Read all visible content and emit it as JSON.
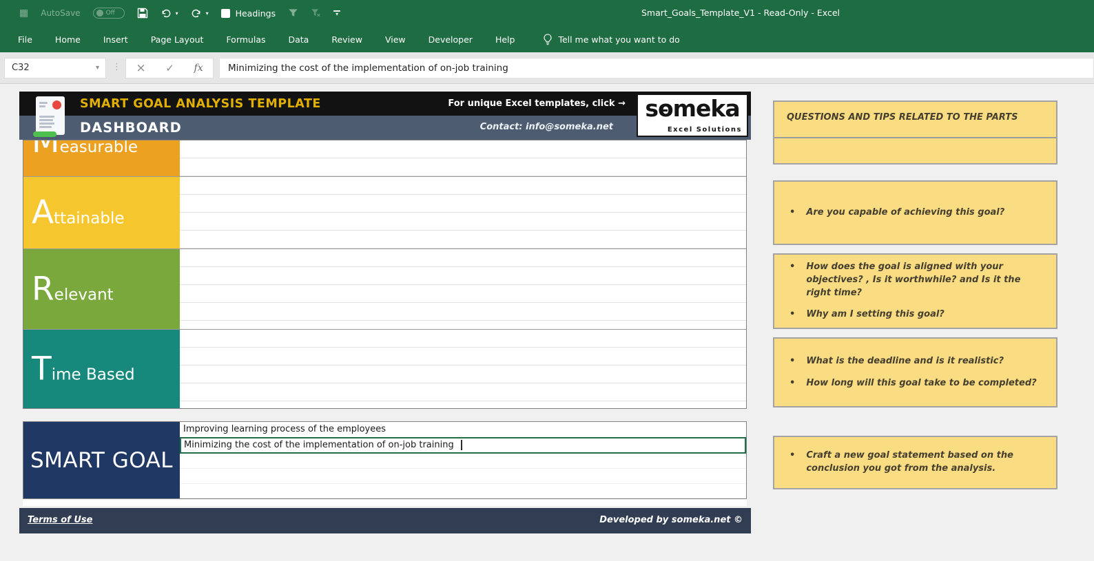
{
  "colors": {
    "excel_green": "#1E6C41",
    "header_black": "#121212",
    "header_slate": "#4D5C70",
    "gold": "#E0AF00",
    "measurable": "#EDA120",
    "attainable": "#F5C62E",
    "relevant": "#7AA83D",
    "time_based": "#16897C",
    "navy": "#203864",
    "footer_slate": "#303D52",
    "tip_bg": "#FADC82",
    "selection_green": "#1E7145"
  },
  "icons": {
    "dropdown": "▾",
    "divider_dots": "⋮",
    "cancel": "×",
    "enter": "✓",
    "fx": "fx",
    "bullet": "•",
    "grid": "▦"
  },
  "titlebar": {
    "autosave_label": "AutoSave",
    "autosave_state": "Off",
    "headings_label": "Headings",
    "window_title": "Smart_Goals_Template_V1  -  Read-Only  -  Excel"
  },
  "ribbon": {
    "tabs": [
      "File",
      "Home",
      "Insert",
      "Page Layout",
      "Formulas",
      "Data",
      "Review",
      "View",
      "Developer",
      "Help"
    ],
    "tell_me": "Tell me what you want to do"
  },
  "formula_bar": {
    "name_box": "C32",
    "formula": "Minimizing the cost of the implementation of on-job training"
  },
  "dashboard": {
    "title": "SMART GOAL ANALYSIS TEMPLATE",
    "subtitle": "DASHBOARD",
    "promo": "For unique Excel templates, click →",
    "contact": "Contact: info@someka.net",
    "logo_text": "someka",
    "logo_tagline": "Excel Solutions"
  },
  "mart_rows": [
    {
      "letter": "M",
      "rest": "easurable"
    },
    {
      "letter": "A",
      "rest": "ttainable"
    },
    {
      "letter": "R",
      "rest": "elevant"
    },
    {
      "letter": "T",
      "rest": "ime Based"
    }
  ],
  "smart_goal": {
    "label": "SMART GOAL",
    "entries": [
      "Improving learning process of the employees",
      "Minimizing the cost of the implementation of on-job training"
    ]
  },
  "footer": {
    "terms": "Terms of Use",
    "developed": "Developed by someka.net ©"
  },
  "tips": {
    "header": "QUESTIONS AND TIPS RELATED TO THE PARTS",
    "attainable": [
      "Are you capable of achieving this goal?"
    ],
    "relevant": [
      "How does the goal is aligned with your objectives? ,  Is it worthwhile?  and Is it the right time?",
      "Why am I setting this goal?"
    ],
    "time_based": [
      "What is the deadline and is it realistic?",
      "How long will this goal take to be completed?"
    ],
    "smart_goal": [
      "Craft a new goal statement based on the conclusion you got from the analysis."
    ]
  }
}
